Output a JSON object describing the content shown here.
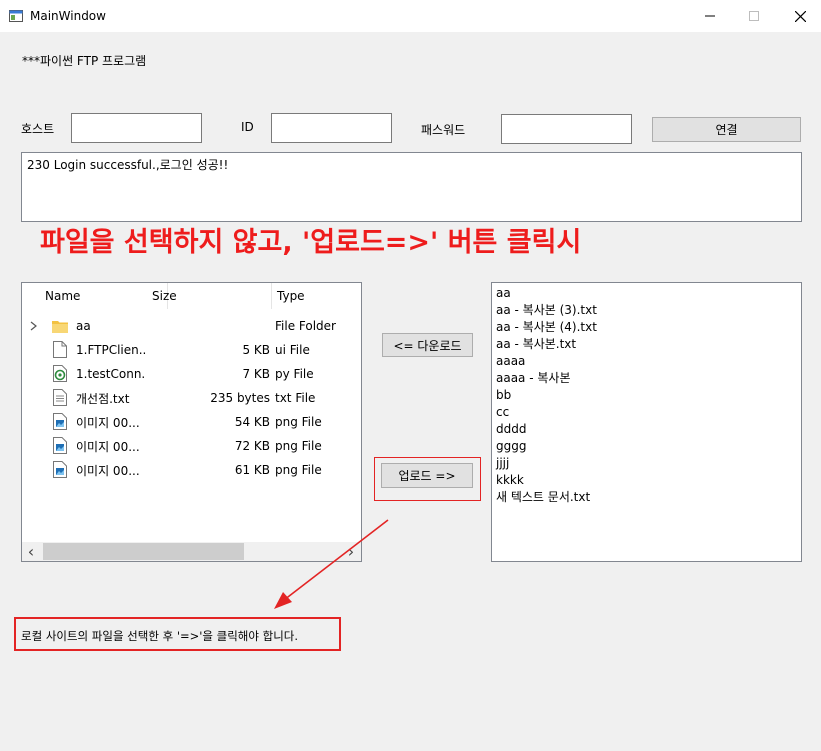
{
  "window": {
    "title": "MainWindow",
    "minimize_glyph": "—",
    "maximize_glyph": "☐",
    "close_glyph": "✕",
    "app_icon": "window-icon"
  },
  "header": {
    "heading": "***파이썬 FTP 프로그램"
  },
  "connection": {
    "host_label": "호스트",
    "host_value": "",
    "id_label": "ID",
    "id_value": "",
    "password_label": "패스워드",
    "password_value": "",
    "connect_label": "연결"
  },
  "log": {
    "text": "230 Login successful.,로그인 성공!!"
  },
  "annotation_top": "파일을 선택하지 않고, '업로드=>' 버튼 클릭시",
  "local_tree": {
    "columns": [
      "Name",
      "Size",
      "Type"
    ],
    "rows": [
      {
        "name": "aa",
        "size": "",
        "type": "File Folder",
        "icon": "folder-icon",
        "expandable": true
      },
      {
        "name": "1.FTPClien...",
        "size": "5 KB",
        "type": "ui File",
        "icon": "file-icon",
        "expandable": false
      },
      {
        "name": "1.testConn...",
        "size": "7 KB",
        "type": "py File",
        "icon": "python-file-icon",
        "expandable": false
      },
      {
        "name": "개선점.txt",
        "size": "235 bytes",
        "type": "txt File",
        "icon": "text-file-icon",
        "expandable": false
      },
      {
        "name": "이미지 00...",
        "size": "54 KB",
        "type": "png File",
        "icon": "image-file-icon",
        "expandable": false
      },
      {
        "name": "이미지 00...",
        "size": "72 KB",
        "type": "png File",
        "icon": "image-file-icon",
        "expandable": false
      },
      {
        "name": "이미지 00...",
        "size": "61 KB",
        "type": "png File",
        "icon": "image-file-icon",
        "expandable": false
      }
    ],
    "scroll_left": "‹",
    "scroll_right": "›"
  },
  "transfer": {
    "download_label": "<= 다운로드",
    "upload_label": "업로드 =>"
  },
  "remote_list": {
    "items": [
      "aa",
      "aa - 복사본 (3).txt",
      "aa - 복사본 (4).txt",
      "aa - 복사본.txt",
      "aaaa",
      "aaaa - 복사본",
      "bb",
      "cc",
      "dddd",
      "gggg",
      "jjjj",
      "kkkk",
      "새 텍스트 문서.txt"
    ]
  },
  "annotation_bottom": "로컬 사이트의 파일을 선택한 후 '=>'을 클릭해야 합니다.",
  "colors": {
    "annotation_red": "#ee1c1c",
    "window_bg": "#f0f0f0"
  }
}
